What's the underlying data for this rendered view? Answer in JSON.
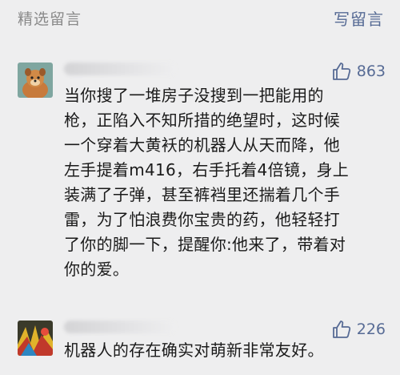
{
  "header": {
    "section_title": "精选留言",
    "write_comment_label": "写留言"
  },
  "colors": {
    "background": "#eeeeef",
    "link": "#576b95",
    "muted_text": "#8a8a8a",
    "body_text": "#1a1a1a"
  },
  "comments": [
    {
      "avatar_icon": "dog-avatar",
      "like_icon": "thumbs-up-icon",
      "likes": "863",
      "text": "当你搜了一堆房子没搜到一把能用的\n枪，正陷入不知所措的绝望时，这时候\n一个穿着大黄袄的机器人从天而降，他\n左手提着m416，右手托着4倍镜，身上\n装满了子弹，甚至裤裆里还揣着几个手\n雷，为了怕浪费你宝贵的药，他轻轻打\n了你的脚一下，提醒你:他来了，带着对\n你的爱。"
    },
    {
      "avatar_icon": "colorful-avatar",
      "like_icon": "thumbs-up-icon",
      "likes": "226",
      "text": "机器人的存在确实对萌新非常友好。"
    }
  ]
}
